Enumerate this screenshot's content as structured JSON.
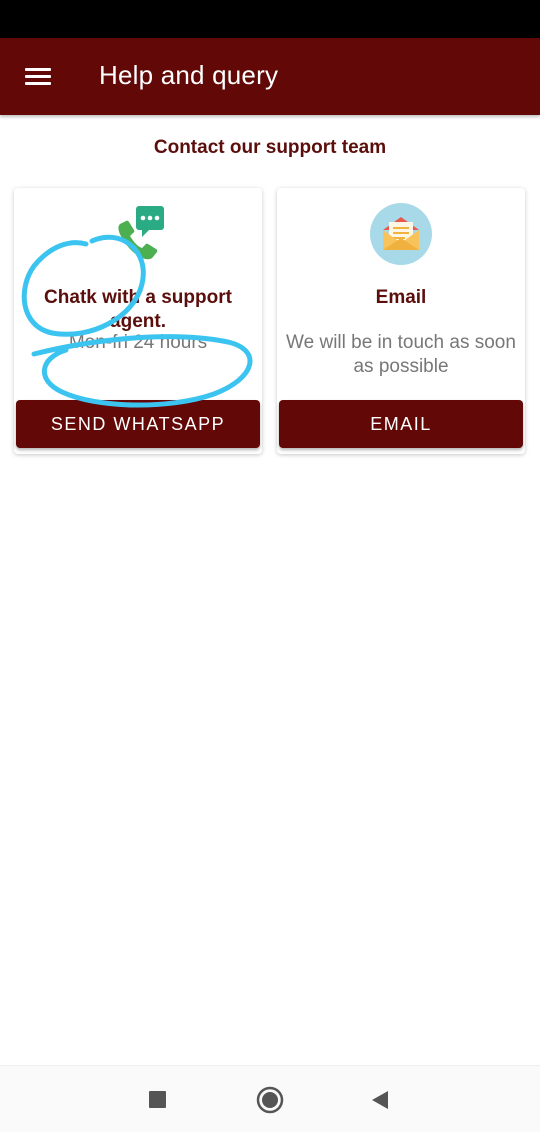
{
  "app_bar": {
    "title": "Help and query",
    "menu_icon": "hamburger-menu-icon"
  },
  "section_title": "Contact our support team",
  "cards": [
    {
      "icon": "whatsapp-chat-icon",
      "title": "Chatk with a support agent.",
      "description": "Mon-fri 24 hours",
      "button_label": "SEND WHATSAPP"
    },
    {
      "icon": "email-envelope-icon",
      "title": "Email",
      "description": "We will be in touch as soon as possible",
      "button_label": "EMAIL"
    }
  ],
  "nav_bar": {
    "items": [
      "recents-icon",
      "home-icon",
      "back-icon"
    ]
  },
  "colors": {
    "primary": "#620807",
    "title_text": "#5b0f0c",
    "annotation": "#3cc4f0"
  }
}
